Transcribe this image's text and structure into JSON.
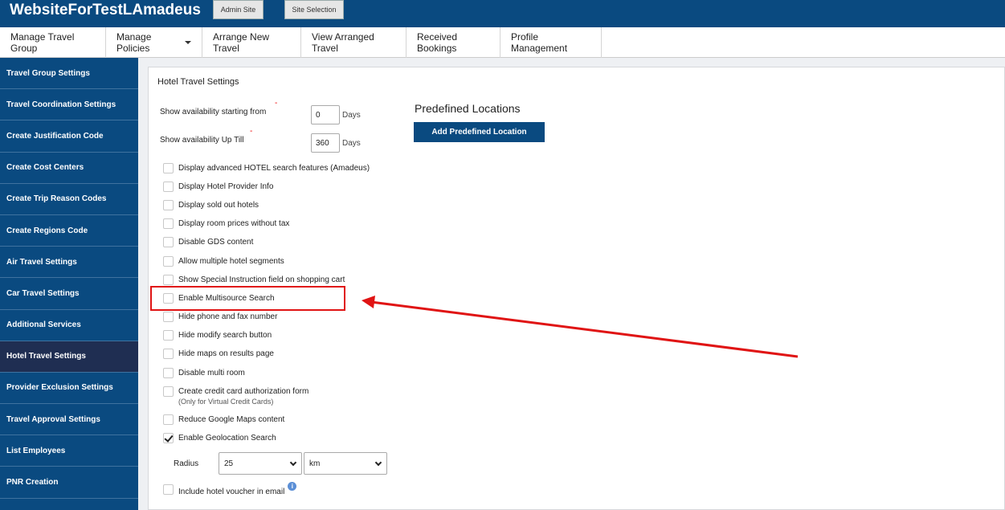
{
  "header": {
    "site_title": "WebsiteForTestLAmadeus",
    "admin_site_label": "Admin Site",
    "site_selection_label": "Site Selection"
  },
  "nav": {
    "items": [
      {
        "label": "Manage Travel Group"
      },
      {
        "label": "Manage Policies",
        "has_dropdown": true
      },
      {
        "label": "Arrange New Travel"
      },
      {
        "label": "View Arranged Travel"
      },
      {
        "label": "Received Bookings"
      },
      {
        "label": "Profile Management"
      }
    ]
  },
  "sidebar": {
    "items": [
      {
        "label": "Travel Group Settings"
      },
      {
        "label": "Travel Coordination Settings"
      },
      {
        "label": "Create Justification Code"
      },
      {
        "label": "Create Cost Centers"
      },
      {
        "label": "Create Trip Reason Codes"
      },
      {
        "label": "Create Regions Code"
      },
      {
        "label": "Air Travel Settings"
      },
      {
        "label": "Car Travel Settings"
      },
      {
        "label": "Additional Services"
      },
      {
        "label": "Hotel Travel Settings",
        "active": true
      },
      {
        "label": "Provider Exclusion Settings"
      },
      {
        "label": "Travel Approval Settings"
      },
      {
        "label": "List Employees"
      },
      {
        "label": "PNR Creation"
      }
    ]
  },
  "main": {
    "title": "Hotel Travel Settings",
    "availability_from": {
      "label": "Show availability starting from",
      "value": "0",
      "unit": "Days",
      "required_mark": "-"
    },
    "availability_until": {
      "label": "Show availability Up Till",
      "value": "360",
      "unit": "Days",
      "required_mark": "-"
    },
    "predefined": {
      "title": "Predefined Locations",
      "button_label": "Add Predefined Location"
    },
    "checkboxes": [
      {
        "label": "Display advanced HOTEL search features (Amadeus)",
        "checked": false
      },
      {
        "label": "Display Hotel Provider Info",
        "checked": false
      },
      {
        "label": "Display sold out hotels",
        "checked": false
      },
      {
        "label": "Display room prices without tax",
        "checked": false
      },
      {
        "label": "Disable GDS content",
        "checked": false
      },
      {
        "label": "Allow multiple hotel segments",
        "checked": false
      },
      {
        "label": "Show Special Instruction field on shopping cart",
        "checked": false
      },
      {
        "label": "Enable Multisource Search",
        "checked": false,
        "highlighted": true
      },
      {
        "label": "Hide phone and fax number",
        "checked": false
      },
      {
        "label": "Hide modify search button",
        "checked": false
      },
      {
        "label": "Hide maps on results page",
        "checked": false
      },
      {
        "label": "Disable multi room",
        "checked": false
      },
      {
        "label": "Create credit card authorization form",
        "sublabel": "(Only for Virtual Credit Cards)",
        "checked": false
      },
      {
        "label": "Reduce Google Maps content",
        "checked": false
      },
      {
        "label": "Enable Geolocation Search",
        "checked": true
      }
    ],
    "radius": {
      "label": "Radius",
      "value": "25",
      "unit": "km"
    },
    "voucher": {
      "label": "Include hotel voucher in email",
      "checked": false,
      "info_icon": "i"
    }
  },
  "annotation": {
    "color": "#e01414"
  }
}
